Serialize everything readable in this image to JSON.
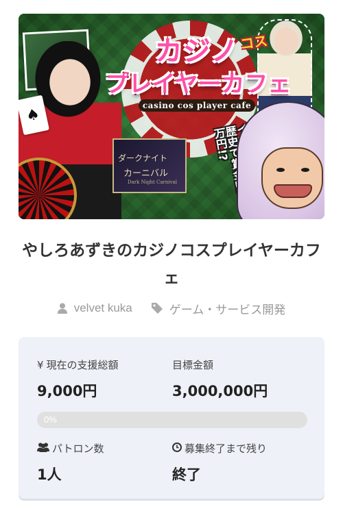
{
  "banner": {
    "title_line1": "カジノ",
    "title_cos": "コス",
    "title_line2": "プレイヤーカフェ",
    "subtitle_en": "casino cos player cafe",
    "event_text": "イベントでは黒歴史で賞金100万円!?",
    "sign_line1": "ダークナイト",
    "sign_line2": "カーニバル",
    "sign_line3": "Dark Night Carnival",
    "card_symbol": "♠"
  },
  "project": {
    "title": "やしろあずきのカジノコスプレイヤーカフェ",
    "owner": "velvet kuka",
    "category": "ゲーム・サービス開発"
  },
  "icons": {
    "owner": "user-icon",
    "category": "tag-icon",
    "patrons": "users-icon",
    "time": "clock-icon"
  },
  "stats": {
    "current_label": "現在の支援総額",
    "current_prefix": "¥",
    "current_value": "9,000円",
    "goal_label": "目標金額",
    "goal_value": "3,000,000円",
    "progress_text": "0%",
    "progress_fraction": 0,
    "patrons_label": "パトロン数",
    "patrons_value": "1人",
    "remaining_label": "募集終了まで残り",
    "remaining_value": "終了"
  },
  "colors": {
    "banner_green": "#2f7b33",
    "title_pink": "#ff4fa8",
    "card_bg": "#eef1f7",
    "muted": "#999999"
  }
}
